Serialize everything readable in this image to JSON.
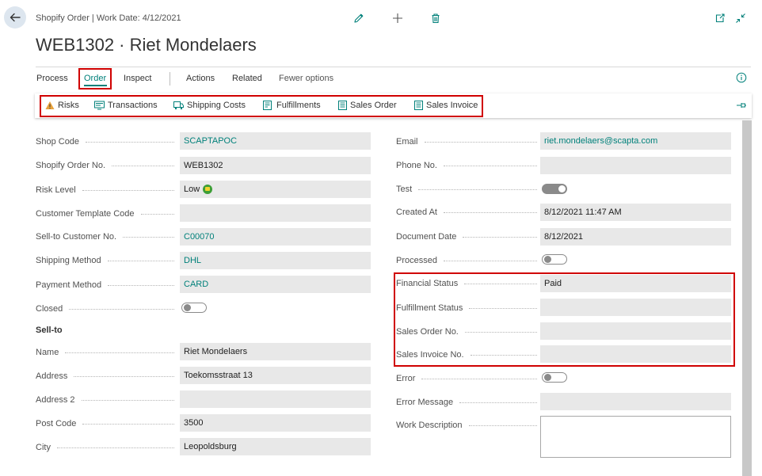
{
  "header": {
    "breadcrumb": "Shopify Order | Work Date: 4/12/2021",
    "title": "WEB1302 · Riet Mondelaers",
    "back_icon": "arrow-left-icon",
    "edit_icon": "pencil-icon",
    "new_icon": "plus-icon",
    "delete_icon": "trash-icon",
    "open_new_window_icon": "open-new-window-icon",
    "collapse_icon": "collapse-icon"
  },
  "actionbar": {
    "tabs": [
      "Process",
      "Order",
      "Inspect",
      "Actions",
      "Related",
      "Fewer options"
    ],
    "selected_tab": "Order",
    "info_icon": "info-icon",
    "pin_icon": "pin-icon"
  },
  "promoted": [
    {
      "label": "Risks",
      "icon": "warning-icon"
    },
    {
      "label": "Transactions",
      "icon": "transactions-icon"
    },
    {
      "label": "Shipping Costs",
      "icon": "shipping-costs-icon"
    },
    {
      "label": "Fulfillments",
      "icon": "fulfillments-icon"
    },
    {
      "label": "Sales Order",
      "icon": "document-icon"
    },
    {
      "label": "Sales Invoice",
      "icon": "invoice-icon"
    }
  ],
  "general": {
    "shop_code": {
      "label": "Shop Code",
      "value": "SCAPTAPOC"
    },
    "order_no": {
      "label": "Shopify Order No.",
      "value": "WEB1302"
    },
    "risk_level": {
      "label": "Risk Level",
      "value": "Low",
      "icon": "low-risk-icon"
    },
    "customer_template": {
      "label": "Customer Template Code",
      "value": ""
    },
    "sell_to_customer_no": {
      "label": "Sell-to Customer No.",
      "value": "C00070"
    },
    "shipping_method": {
      "label": "Shipping Method",
      "value": "DHL"
    },
    "payment_method": {
      "label": "Payment Method",
      "value": "CARD"
    },
    "closed": {
      "label": "Closed",
      "value": false
    }
  },
  "sell_to": {
    "heading": "Sell-to",
    "name": {
      "label": "Name",
      "value": "Riet Mondelaers"
    },
    "address": {
      "label": "Address",
      "value": "Toekomsstraat 13"
    },
    "address2": {
      "label": "Address 2",
      "value": ""
    },
    "post_code": {
      "label": "Post Code",
      "value": "3500"
    },
    "city": {
      "label": "City",
      "value": "Leopoldsburg"
    }
  },
  "right": {
    "email": {
      "label": "Email",
      "value": "riet.mondelaers@scapta.com"
    },
    "phone": {
      "label": "Phone No.",
      "value": ""
    },
    "test": {
      "label": "Test",
      "value": true
    },
    "created_at": {
      "label": "Created At",
      "value": "8/12/2021 11:47 AM"
    },
    "document_date": {
      "label": "Document Date",
      "value": "8/12/2021"
    },
    "processed": {
      "label": "Processed",
      "value": false
    },
    "financial_status": {
      "label": "Financial Status",
      "value": "Paid"
    },
    "fulfillment_status": {
      "label": "Fulfillment Status",
      "value": ""
    },
    "sales_order_no": {
      "label": "Sales Order No.",
      "value": ""
    },
    "sales_invoice_no": {
      "label": "Sales Invoice No.",
      "value": ""
    },
    "error": {
      "label": "Error",
      "value": false
    },
    "error_message": {
      "label": "Error Message",
      "value": ""
    },
    "work_description": {
      "label": "Work Description",
      "value": ""
    }
  },
  "colors": {
    "accent": "#00807a",
    "highlight_border": "#d00000",
    "field_bg": "#e8e8e8"
  }
}
